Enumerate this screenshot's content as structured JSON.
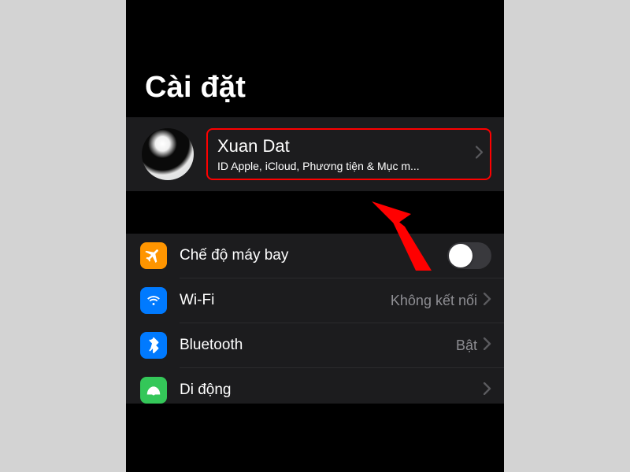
{
  "title": "Cài đặt",
  "account": {
    "name": "Xuan Dat",
    "subtitle": "ID Apple, iCloud, Phương tiện & Mục m..."
  },
  "rows": {
    "airplane": {
      "label": "Chế độ máy bay",
      "toggled": false
    },
    "wifi": {
      "label": "Wi-Fi",
      "value": "Không kết nối"
    },
    "bluetooth": {
      "label": "Bluetooth",
      "value": "Bật"
    },
    "cellular": {
      "label": "Di động"
    }
  },
  "annotation": {
    "highlight_target": "account-row",
    "arrow_color": "#ff0000"
  }
}
